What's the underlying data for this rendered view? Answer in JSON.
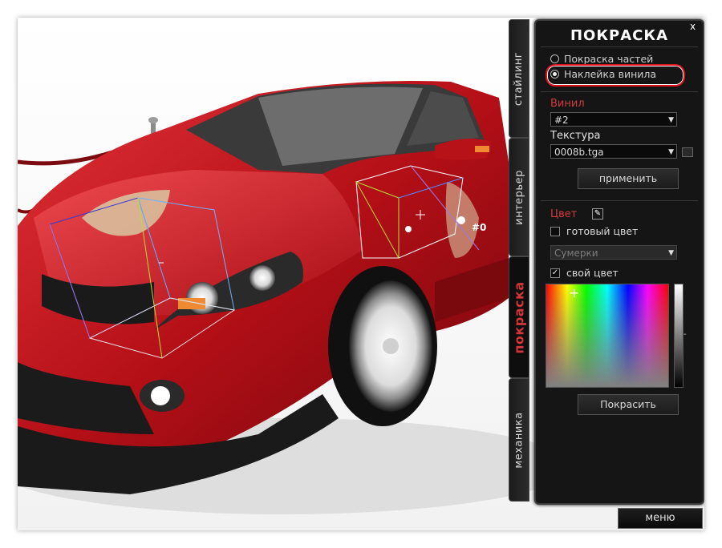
{
  "tabs": {
    "styling": "стайлинг",
    "interior": "интерьер",
    "paint": "покраска",
    "mechanics": "механика"
  },
  "panel": {
    "title": "ПОКРАСКА",
    "close": "x",
    "radio_parts": "Покраска частей",
    "radio_vinyl": "Наклейка винила",
    "vinyl_label": "Винил",
    "vinyl_value": "#2",
    "texture_label": "Текстура",
    "texture_value": "0008b.tga",
    "apply_button": "применить",
    "color_label": "Цвет",
    "ready_color": "готовый цвет",
    "preset_value": "Сумерки",
    "own_color": "свой цвет",
    "own_color_checked": true,
    "paint_button": "Покрасить"
  },
  "scene": {
    "marker": "#0"
  },
  "menu_button": "меню",
  "colors": {
    "accent_red": "#d4343a",
    "highlight_red": "#e0111c",
    "car_red": "#c5121b"
  }
}
